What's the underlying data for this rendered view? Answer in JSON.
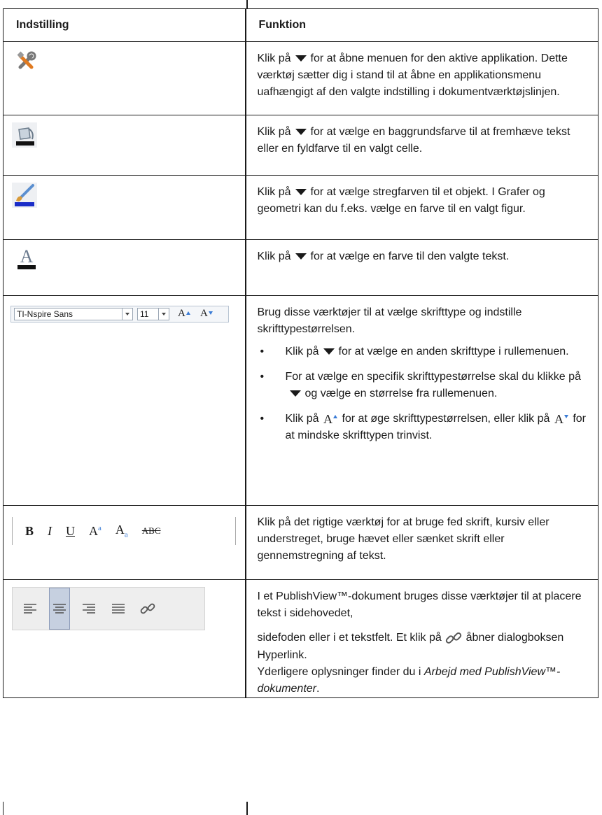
{
  "table": {
    "headers": {
      "setting": "Indstilling",
      "function": "Funktion"
    },
    "rows": [
      {
        "icon": "tools-icon",
        "text": [
          "Klik på",
          "for at åbne menuen for den aktive applikation. Dette værktøj sætter dig i stand til at åbne en applikationsmenu uafhængigt af den valgte indstilling i dokumentværktøjslinjen."
        ]
      },
      {
        "icon": "paint-bucket-icon",
        "text": [
          "Klik på",
          "for at vælge en baggrundsfarve til at fremhæve tekst eller en fyldfarve til en valgt celle."
        ]
      },
      {
        "icon": "brush-icon",
        "text": [
          "Klik på",
          "for at vælge stregfarven til et objekt. I Grafer  og geometri kan du f.eks. vælge en farve til en valgt figur."
        ]
      },
      {
        "icon": "text-color-icon",
        "text": [
          "Klik på",
          "for at vælge en farve til den valgte tekst."
        ]
      },
      {
        "toolbar": {
          "font_name": "TI-Nspire Sans",
          "font_size": "11",
          "grow": "A",
          "shrink": "A"
        },
        "intro": "Brug disse værktøjer til at vælge skrifttype og indstille skrifttypestørrelsen.",
        "bullets": [
          {
            "a": "Klik på",
            "b": "for at vælge en anden skrifttype i rullemenuen."
          },
          {
            "a": "For at vælge en specifik skrifttypestørrelse skal du klikke på",
            "b": "og vælge en størrelse fra rullemenuen."
          },
          {
            "a": "Klik på",
            "b": "for at øge skrifttypestørrelsen, eller klik på",
            "c": "for at mindske skrifttypen trinvist."
          }
        ]
      },
      {
        "toolbar": {
          "bold": "B",
          "italic": "I",
          "underline": "U",
          "sup": "A",
          "sub": "A",
          "strike": "ABC",
          "sup_mark": "a",
          "sub_mark": "a"
        },
        "text": "Klik på det rigtige værktøj for at bruge fed skrift, kursiv eller understreget, bruge hævet eller sænket skrift eller gennemstregning af tekst."
      },
      {
        "toolbar": [
          "align-left-icon",
          "align-center-icon",
          "align-right-icon",
          "align-justify-icon",
          "hyperlink-icon"
        ],
        "p1": "I et PublishView™-dokument bruges disse værktøjer til at placere tekst i sidehovedet,",
        "p2a": "sidefoden eller i et tekstfelt. Et klik på",
        "p2b": "åbner dialogboksen Hyperlink.",
        "p3a": "Yderligere oplysninger finder du i",
        "p3b": "Arbejd med PublishView™-dokumenter",
        "p3c": "."
      }
    ]
  }
}
